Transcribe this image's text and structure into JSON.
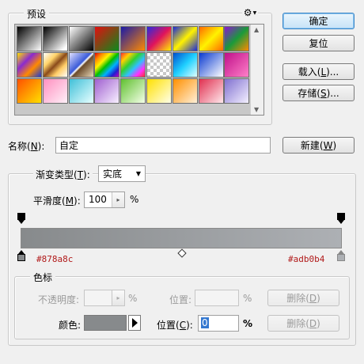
{
  "presets": {
    "title": "预设",
    "gear_icon": "gear-icon",
    "swatches": [
      {
        "name": "foreground-to-background",
        "bg": "linear-gradient(135deg,#000 0%,#fff 100%)"
      },
      {
        "name": "foreground-to-transparent",
        "bg": "linear-gradient(135deg,#000 0%,#ffffff 90%)"
      },
      {
        "name": "black-white",
        "bg": "linear-gradient(135deg,#fff 0%,#000 100%)"
      },
      {
        "name": "red-green",
        "bg": "linear-gradient(135deg,#e11010 0%,#0b8a1c 100%)"
      },
      {
        "name": "violet-orange",
        "bg": "linear-gradient(135deg,#1a1aa8 0%,#ff8a00 100%)"
      },
      {
        "name": "blue-red-yellow",
        "bg": "linear-gradient(135deg,#2a2adf 0%,#e0135c 50%,#fff200 100%)"
      },
      {
        "name": "blue-yellow-blue",
        "bg": "linear-gradient(135deg,#1a2ad8 0%,#fff200 50%,#1a2ad8 100%)"
      },
      {
        "name": "orange-yellow-orange",
        "bg": "linear-gradient(135deg,#ff6a00 0%,#fff200 50%,#ff6a00 100%)"
      },
      {
        "name": "violet-green-orange",
        "bg": "linear-gradient(135deg,#8a1ad0 0%,#1a9a3a 50%,#ff8a00 100%)"
      },
      {
        "name": "yellow-violet-orange-blue",
        "bg": "linear-gradient(135deg,#ffe000 0%,#8a2ad0 35%,#ff8a00 65%,#1a3ad8 100%)"
      },
      {
        "name": "copper",
        "bg": "linear-gradient(135deg,#fff 0%,#ffd36a 30%,#8a4a1a 50%,#ffcc66 70%,#fff 100%)"
      },
      {
        "name": "chrome",
        "bg": "linear-gradient(135deg,#e0e0ff 0%,#3a5ad8 45%,#fff 50%,#6a4a2a 55%,#e8d8b8 100%)"
      },
      {
        "name": "spectrum",
        "bg": "linear-gradient(135deg,#e00000,#ff8a00,#fff200,#00c000,#00b0ff,#2020d0,#c000c0)"
      },
      {
        "name": "transparent-rainbow",
        "bg": "linear-gradient(135deg,#ff3030,#ffd000,#30d030,#30c0ff,#ff30ff,#ff3030)"
      },
      {
        "name": "transparent-stripes",
        "bg": "checker"
      },
      {
        "name": "cyan-gradient",
        "bg": "linear-gradient(135deg,#0050d0 0%,#20d0ff 50%,#e0ffff 100%)"
      },
      {
        "name": "blue-white",
        "bg": "linear-gradient(135deg,#0a3ad0 0%,#ffffff 100%)"
      },
      {
        "name": "purple-pink",
        "bg": "linear-gradient(135deg,#c0108a 0%,#ff80c8 100%)"
      },
      {
        "name": "orange-yellow",
        "bg": "linear-gradient(135deg,#ff5000 0%,#ffe000 100%)"
      },
      {
        "name": "pink-light",
        "bg": "linear-gradient(135deg,#ff90c0 0%,#fff0f8 100%)"
      },
      {
        "name": "cyan-white",
        "bg": "linear-gradient(135deg,#40c0d8 0%,#e8ffff 100%)"
      },
      {
        "name": "violet-pale",
        "bg": "linear-gradient(135deg,#a060d0 0%,#f8f0ff 100%)"
      },
      {
        "name": "green-pale",
        "bg": "linear-gradient(135deg,#60c030 0%,#f4ffe8 100%)"
      },
      {
        "name": "yellow-pale",
        "bg": "linear-gradient(135deg,#ffe000 0%,#ffffe8 100%)"
      },
      {
        "name": "orange-pale",
        "bg": "linear-gradient(135deg,#ff9000 0%,#fff0d8 100%)"
      },
      {
        "name": "red-pale",
        "bg": "linear-gradient(135deg,#e03050 0%,#ffe8ec 100%)"
      },
      {
        "name": "lavender-pale",
        "bg": "linear-gradient(135deg,#8070d0 0%,#f4f0ff 100%)"
      }
    ]
  },
  "buttons": {
    "ok": "确定",
    "reset": "复位",
    "load_pre": "载入(",
    "load_key": "L",
    "load_post": ")...",
    "save_pre": "存储(",
    "save_key": "S",
    "save_post": ")...",
    "new_pre": "新建(",
    "new_key": "W",
    "new_post": ")"
  },
  "name_row": {
    "label_pre": "名称(",
    "label_key": "N",
    "label_post": "):",
    "value": "自定"
  },
  "gradient": {
    "type_label_pre": "渐变类型(",
    "type_label_key": "T",
    "type_label_post": "):",
    "type_value": "实底",
    "smooth_label_pre": "平滑度(",
    "smooth_label_key": "M",
    "smooth_label_post": "):",
    "smooth_value": "100",
    "smooth_unit": "%",
    "color_left": "#878a8c",
    "color_right": "#adb0b4",
    "left_hex_label": "#878a8c",
    "right_hex_label": "#adb0b4"
  },
  "stops": {
    "title": "色标",
    "opacity_label": "不透明度:",
    "opacity_value": "",
    "opacity_unit": "%",
    "opacity_pos_label": "位置:",
    "opacity_pos_value": "",
    "opacity_pos_unit": "%",
    "opacity_delete_pre": "删除(",
    "opacity_delete_key": "D",
    "opacity_delete_post": ")",
    "color_label": "颜色:",
    "color_swatch": "#878a8c",
    "color_pos_label_pre": "位置(",
    "color_pos_label_key": "C",
    "color_pos_label_post": "):",
    "color_pos_value": "0",
    "color_pos_unit": "%",
    "color_delete_pre": "删除(",
    "color_delete_key": "D",
    "color_delete_post": ")"
  }
}
